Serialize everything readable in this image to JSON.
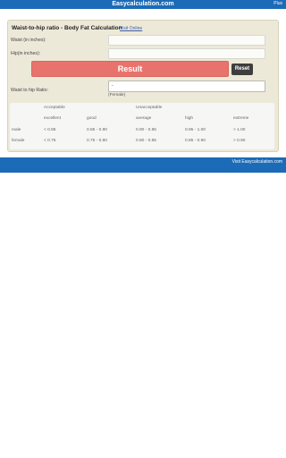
{
  "topbar": {
    "site": "Easycalculation.com",
    "more": "Plus"
  },
  "card": {
    "title": "Waist-to-hip ratio - Body Fat Calculation",
    "title_link": "Visit Online",
    "waist_label": "Waist (in inches):",
    "hip_label": "Hip(in inches):",
    "result_button": "Result",
    "reset_button": "Reset",
    "ratio_label": "Waist to hip Ratio:",
    "ratio_value": "-",
    "ratio_hint": "(Female)"
  },
  "table": {
    "group_headers": [
      "Acceptable",
      "Unacceptable"
    ],
    "columns": [
      "excellent",
      "good",
      "average",
      "high",
      "extreme"
    ],
    "rows": [
      {
        "label": "male",
        "values": [
          "< 0.85",
          "0.85 - 0.90",
          "0.90 - 0.95",
          "0.95 - 1.00",
          "> 1.00"
        ]
      },
      {
        "label": "female",
        "values": [
          "< 0.75",
          "0.75 - 0.80",
          "0.80 - 0.85",
          "0.85 - 0.90",
          "> 0.90"
        ]
      }
    ]
  },
  "footer": {
    "visit_link": "Visit Easycalculation.com"
  }
}
